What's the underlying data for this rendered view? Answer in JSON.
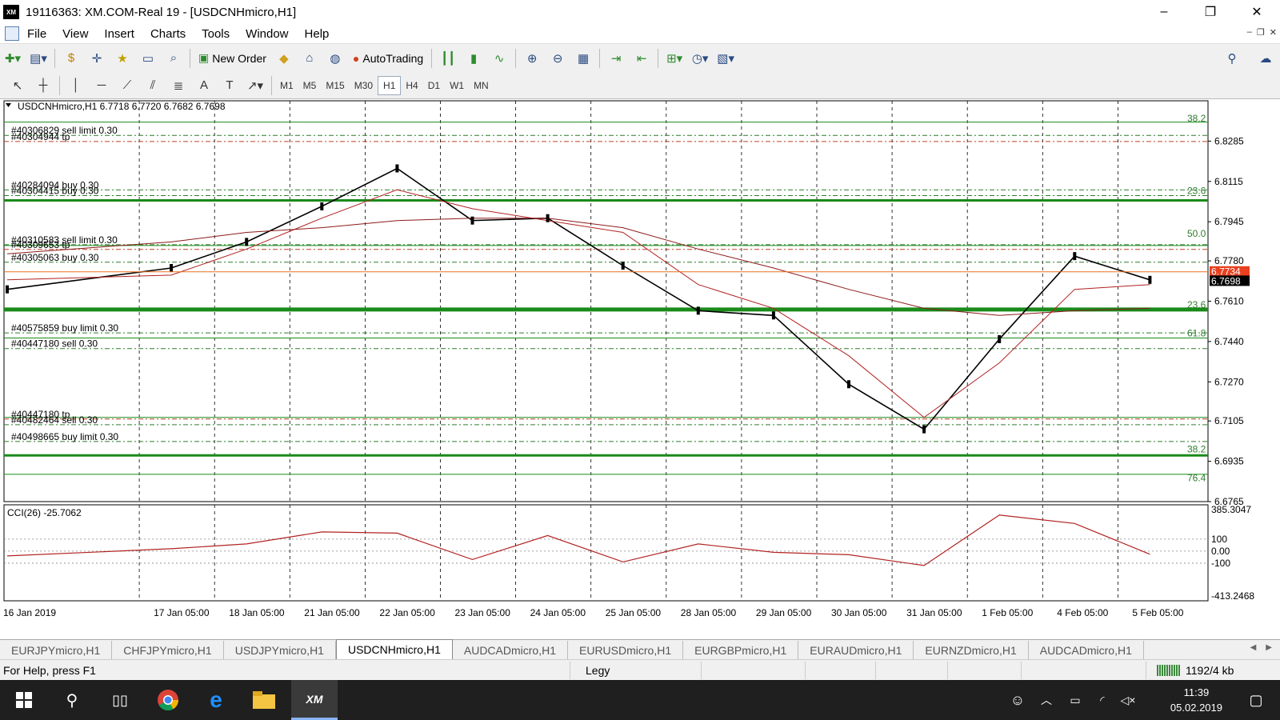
{
  "title": {
    "app_badge": "XM",
    "text": "19116363: XM.COM-Real 19 - [USDCNHmicro,H1]"
  },
  "window_controls": {
    "minimize": "–",
    "maximize": "❐",
    "close": "✕"
  },
  "menu": [
    "File",
    "View",
    "Insert",
    "Charts",
    "Tools",
    "Window",
    "Help"
  ],
  "toolbar": {
    "new_order": "New Order",
    "autotrading": "AutoTrading"
  },
  "timeframes": [
    "M1",
    "M5",
    "M15",
    "M30",
    "H1",
    "H4",
    "D1",
    "W1",
    "MN"
  ],
  "active_timeframe": "H1",
  "chart": {
    "header": "USDCNHmicro,H1  6.7718 6.7720 6.7682 6.7698",
    "price_labels": [
      "6.8285",
      "6.8115",
      "6.7945",
      "6.7780",
      "6.7610",
      "6.7440",
      "6.7270",
      "6.7105",
      "6.6935",
      "6.6765"
    ],
    "current_prices": {
      "ask": "6.7734",
      "bid": "6.7698"
    },
    "date_labels": [
      "16 Jan 2019",
      "17 Jan 05:00",
      "18 Jan 05:00",
      "21 Jan 05:00",
      "22 Jan 05:00",
      "23 Jan 05:00",
      "24 Jan 05:00",
      "25 Jan 05:00",
      "28 Jan 05:00",
      "29 Jan 05:00",
      "30 Jan 05:00",
      "31 Jan 05:00",
      "1 Feb 05:00",
      "4 Feb 05:00",
      "5 Feb 05:00"
    ],
    "fibo_labels": [
      {
        "text": "38.2",
        "y": 6.836
      },
      {
        "text": "23.6",
        "y": 6.8055
      },
      {
        "text": "50.0",
        "y": 6.7875
      },
      {
        "text": "23.6",
        "y": 6.7575
      },
      {
        "text": "61.8",
        "y": 6.7455
      },
      {
        "text": "38.2",
        "y": 6.6965
      },
      {
        "text": "76.4",
        "y": 6.6845
      }
    ],
    "order_labels": [
      {
        "text": "#40306829 sell limit 0.30",
        "y": 6.8316
      },
      {
        "text": "#40304944 tp",
        "y": 6.829
      },
      {
        "text": "#40284094 buy 0.30",
        "y": 6.8086
      },
      {
        "text": "#40304415 buy 0.30",
        "y": 6.8062
      },
      {
        "text": "#40310583 sell limit 0.30",
        "y": 6.7855
      },
      {
        "text": "#40309653 tp",
        "y": 6.7835
      },
      {
        "text": "#40305063 buy 0.30",
        "y": 6.7781
      },
      {
        "text": "#40575859 buy limit 0.30",
        "y": 6.7483
      },
      {
        "text": "#40447180 sell 0.30",
        "y": 6.7417
      },
      {
        "text": "#40447180 tp",
        "y": 6.712
      },
      {
        "text": "#40482464 sell 0.30",
        "y": 6.7096
      },
      {
        "text": "#40498665 buy limit 0.30",
        "y": 6.7025
      }
    ],
    "cci_header": "CCI(26) -25.7062",
    "cci_labels": [
      "385.3047",
      "100",
      "0.00",
      "-100",
      "-413.2468"
    ]
  },
  "chart_data": {
    "type": "line",
    "symbol": "USDCNHmicro",
    "timeframe": "H1",
    "x": [
      "16 Jan 2019",
      "17 Jan 05:00",
      "18 Jan 05:00",
      "21 Jan 05:00",
      "22 Jan 05:00",
      "23 Jan 05:00",
      "24 Jan 05:00",
      "25 Jan 05:00",
      "28 Jan 05:00",
      "29 Jan 05:00",
      "30 Jan 05:00",
      "31 Jan 05:00",
      "1 Feb 05:00",
      "4 Feb 05:00",
      "5 Feb 05:00"
    ],
    "series": [
      {
        "values": [
          6.766,
          6.775,
          6.786,
          6.801,
          6.817,
          6.795,
          6.796,
          6.776,
          6.757,
          6.755,
          6.726,
          6.707,
          6.745,
          6.78,
          6.77
        ]
      },
      {
        "values": [
          6.77,
          6.772,
          6.783,
          6.796,
          6.808,
          6.8,
          6.795,
          6.79,
          6.768,
          6.758,
          6.738,
          6.712,
          6.735,
          6.766,
          6.768
        ]
      },
      {
        "values": [
          6.781,
          6.786,
          6.79,
          6.792,
          6.795,
          6.796,
          6.796,
          6.792,
          6.783,
          6.775,
          6.766,
          6.758,
          6.755,
          6.757,
          6.758
        ]
      }
    ],
    "ylim": [
      6.6765,
      6.8455
    ],
    "cci_ylim": [
      -413.2468,
      385.3047
    ],
    "cci": [
      -40,
      20,
      60,
      160,
      150,
      -70,
      130,
      -90,
      60,
      -10,
      -30,
      -120,
      300,
      230,
      -25.7
    ],
    "horizontal_lines": [
      6.8035,
      6.7575,
      6.696
    ]
  },
  "tabs": [
    "EURJPYmicro,H1",
    "CHFJPYmicro,H1",
    "USDJPYmicro,H1",
    "USDCNHmicro,H1",
    "AUDCADmicro,H1",
    "EURUSDmicro,H1",
    "EURGBPmicro,H1",
    "EURAUDmicro,H1",
    "EURNZDmicro,H1",
    "AUDCADmicro,H1"
  ],
  "active_tab": "USDCNHmicro,H1",
  "status": {
    "help": "For Help, press F1",
    "profile": "Legy",
    "traffic": "1192/4 kb"
  },
  "clock": {
    "time": "11:39",
    "date": "05.02.2019"
  }
}
